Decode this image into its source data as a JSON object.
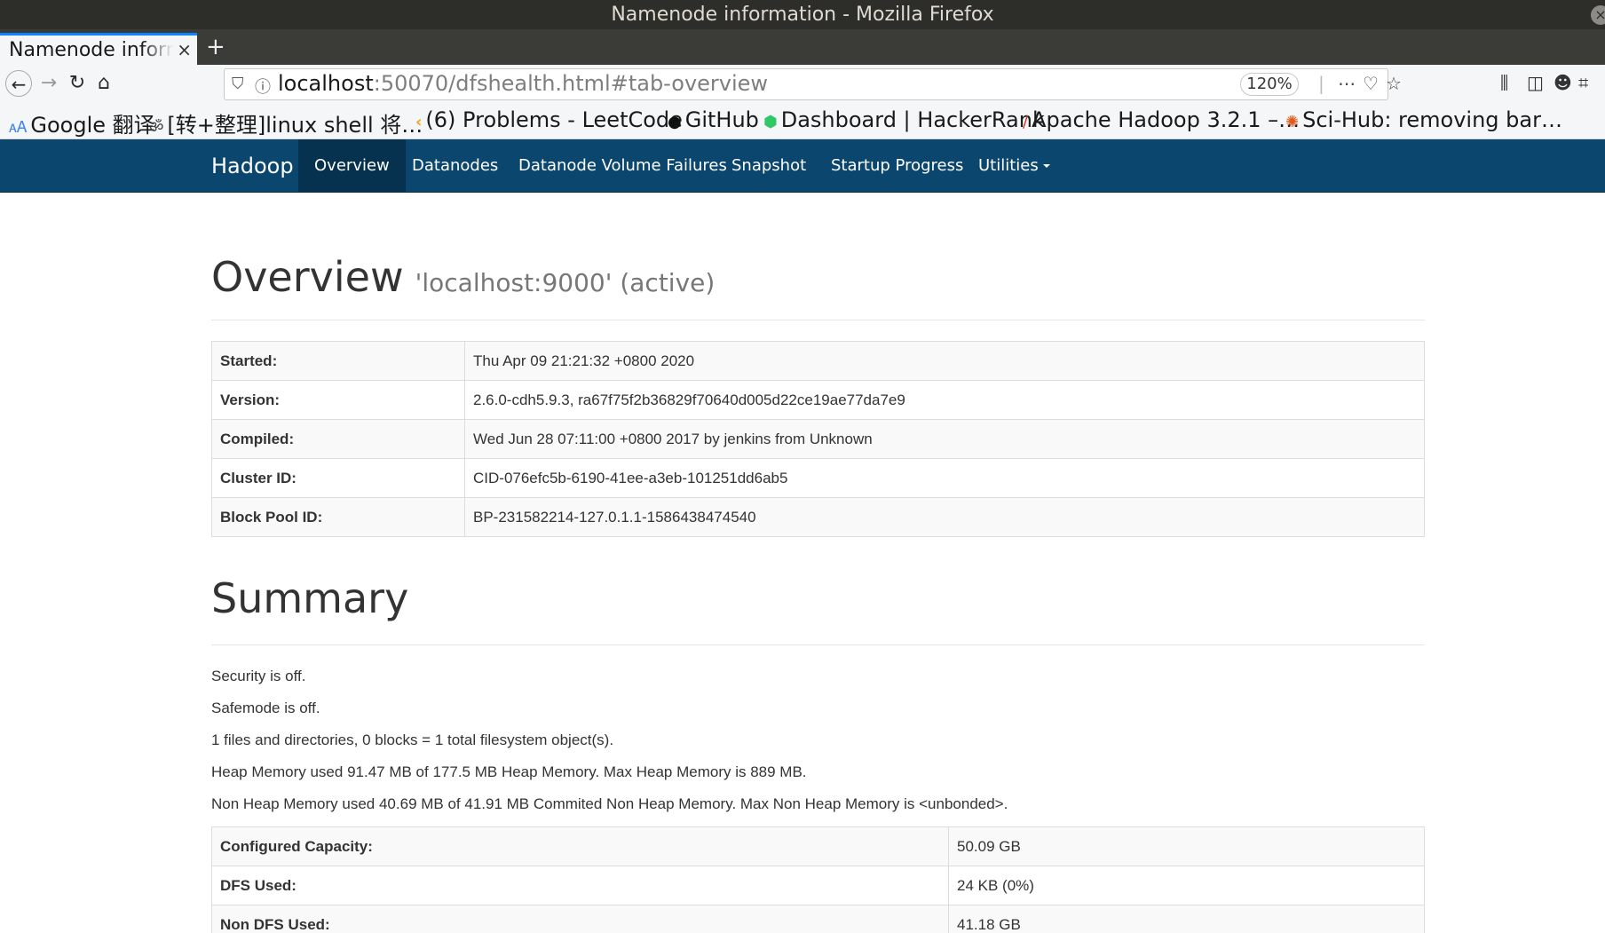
{
  "window": {
    "title": "Namenode information - Mozilla Firefox"
  },
  "tab": {
    "title": "Namenode information",
    "close": "×",
    "new_tab": "+"
  },
  "navbar": {
    "url_host": "localhost",
    "url_rest": ":50070/dfshealth.html#tab-overview",
    "zoom": "120%"
  },
  "bookmarks": [
    {
      "icon": "google-translate-icon",
      "glyph": "🗚",
      "label": "Google 翻译"
    },
    {
      "icon": "linux-shell-icon",
      "glyph": "ॐ",
      "label": "[转+整理]linux shell 将…"
    },
    {
      "icon": "leetcode-icon",
      "glyph": "‹",
      "label": "(6) Problems - LeetCode"
    },
    {
      "icon": "github-icon",
      "glyph": "●",
      "label": "GitHub"
    },
    {
      "icon": "hackerrank-icon",
      "glyph": "⬢",
      "label": "Dashboard | HackerRank"
    },
    {
      "icon": "hadoop-feather-icon",
      "glyph": "/",
      "label": "Apache Hadoop 3.2.1 –…"
    },
    {
      "icon": "scihub-icon",
      "glyph": "✺",
      "label": "Sci-Hub: removing bar…"
    }
  ],
  "hadoop_nav": {
    "brand": "Hadoop",
    "items": [
      "Overview",
      "Datanodes",
      "Datanode Volume Failures",
      "Snapshot",
      "Startup Progress",
      "Utilities"
    ],
    "active": "Overview"
  },
  "overview": {
    "title": "Overview",
    "subtitle": "'localhost:9000' (active)",
    "rows": [
      {
        "key": "Started:",
        "value": "Thu Apr 09 21:21:32 +0800 2020"
      },
      {
        "key": "Version:",
        "value": "2.6.0-cdh5.9.3, ra67f75f2b36829f70640d005d22ce19ae77da7e9"
      },
      {
        "key": "Compiled:",
        "value": "Wed Jun 28 07:11:00 +0800 2017 by jenkins from Unknown"
      },
      {
        "key": "Cluster ID:",
        "value": "CID-076efc5b-6190-41ee-a3eb-101251dd6ab5"
      },
      {
        "key": "Block Pool ID:",
        "value": "BP-231582214-127.0.1.1-1586438474540"
      }
    ]
  },
  "summary": {
    "title": "Summary",
    "lines": [
      "Security is off.",
      "Safemode is off.",
      "1 files and directories, 0 blocks = 1 total filesystem object(s).",
      "Heap Memory used 91.47 MB of 177.5 MB Heap Memory. Max Heap Memory is 889 MB.",
      "Non Heap Memory used 40.69 MB of 41.91 MB Commited Non Heap Memory. Max Non Heap Memory is <unbonded>."
    ],
    "rows": [
      {
        "key": "Configured Capacity:",
        "value": "50.09 GB"
      },
      {
        "key": "DFS Used:",
        "value": "24 KB (0%)"
      },
      {
        "key": "Non DFS Used:",
        "value": "41.18 GB"
      }
    ]
  }
}
